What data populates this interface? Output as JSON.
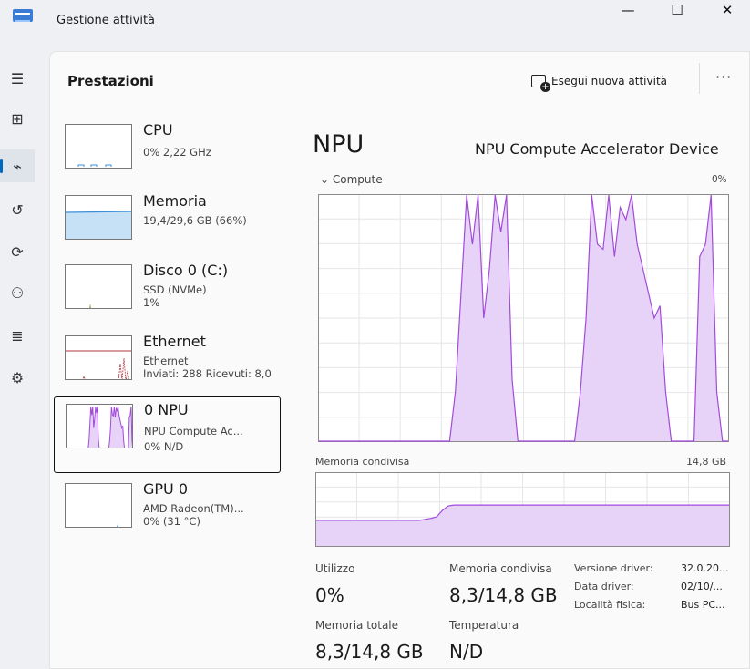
{
  "window": {
    "title": "Gestione attività",
    "minimize_glyph": "—",
    "maximize_glyph": "☐",
    "close_glyph": "✕"
  },
  "rail": {
    "items": [
      {
        "icon": "hamburger-icon",
        "glyph": "☰"
      },
      {
        "icon": "processes-icon",
        "glyph": "⊞"
      },
      {
        "icon": "performance-icon",
        "glyph": "⌁",
        "active": true
      },
      {
        "icon": "app-history-icon",
        "glyph": "↺"
      },
      {
        "icon": "startup-apps-icon",
        "glyph": "⟳"
      },
      {
        "icon": "users-icon",
        "glyph": "⚇"
      },
      {
        "icon": "details-icon",
        "glyph": "≣"
      },
      {
        "icon": "services-icon",
        "glyph": "⚙"
      }
    ]
  },
  "header": {
    "title": "Prestazioni",
    "run_task_label": "Esegui nuova attività",
    "more_glyph": "···"
  },
  "sidebar": {
    "items": [
      {
        "name": "CPU",
        "line1": "0% 2,22 GHz",
        "line2": ""
      },
      {
        "name": "Memoria",
        "line1": "19,4/29,6 GB (66%)",
        "line2": ""
      },
      {
        "name": "Disco 0 (C:)",
        "line1": "SSD (NVMe)",
        "line2": "1%"
      },
      {
        "name": "Ethernet",
        "line1": "Ethernet",
        "line2": "Inviati: 288 Ricevuti: 8,0"
      },
      {
        "name": "0 NPU",
        "line1": "NPU Compute Ac...",
        "line2": "0% N/D",
        "selected": true
      },
      {
        "name": "GPU 0",
        "line1": "AMD Radeon(TM)...",
        "line2": "0% (31 °C)"
      }
    ]
  },
  "detail": {
    "title": "NPU",
    "device": "NPU Compute Accelerator Device",
    "compute_label": "Compute",
    "compute_max": "0%",
    "shared_label": "Memoria condivisa",
    "shared_max": "14,8 GB",
    "stats": {
      "utilization_label": "Utilizzo",
      "utilization_value": "0%",
      "shared_label": "Memoria condivisa",
      "shared_value": "8,3/14,8 GB",
      "total_label": "Memoria totale",
      "total_value": "8,3/14,8 GB",
      "temp_label": "Temperatura",
      "temp_value": "N/D"
    },
    "info": [
      {
        "key": "Versione driver:",
        "value": "32.0.20..."
      },
      {
        "key": "Data driver:",
        "value": "02/10/..."
      },
      {
        "key": "Località fisica:",
        "value": "Bus PC..."
      }
    ]
  },
  "colors": {
    "npu_line": "#a24bd9",
    "npu_fill": "#e7d3f7",
    "memory_line": "#3f8fd6",
    "memory_fill": "#c6e0f5",
    "disk_line": "#6a9a2a",
    "ethernet_line": "#b2363d",
    "accent": "#0067c0"
  },
  "chart_data": [
    {
      "type": "area",
      "title": "Compute",
      "y_max_label": "0%",
      "ylim": [
        0,
        100
      ],
      "grid": true,
      "values": [
        0,
        0,
        0,
        0,
        0,
        0,
        0,
        0,
        0,
        0,
        0,
        0,
        0,
        0,
        0,
        0,
        0,
        0,
        0,
        0,
        0,
        0,
        0,
        0,
        20,
        60,
        100,
        80,
        100,
        50,
        70,
        100,
        85,
        100,
        25,
        0,
        0,
        0,
        0,
        0,
        0,
        0,
        0,
        0,
        0,
        0,
        20,
        50,
        100,
        80,
        78,
        100,
        75,
        95,
        90,
        100,
        80,
        70,
        60,
        50,
        55,
        20,
        0,
        0,
        0,
        0,
        0,
        75,
        80,
        100,
        20,
        0,
        0
      ]
    },
    {
      "type": "area",
      "title": "Memoria condivisa",
      "y_max_label": "14,8 GB",
      "ylim": [
        0,
        14.8
      ],
      "grid": true,
      "values": [
        5.2,
        5.2,
        5.2,
        5.2,
        5.2,
        5.2,
        5.2,
        5.2,
        5.2,
        5.2,
        5.2,
        5.2,
        5.2,
        5.2,
        5.2,
        5.2,
        5.2,
        5.2,
        5.2,
        5.4,
        5.6,
        5.9,
        7.2,
        8.1,
        8.3,
        8.3,
        8.3,
        8.3,
        8.3,
        8.3,
        8.3,
        8.3,
        8.3,
        8.3,
        8.3,
        8.3,
        8.3,
        8.3,
        8.3,
        8.3,
        8.3,
        8.3,
        8.3,
        8.3,
        8.3,
        8.3,
        8.3,
        8.3,
        8.3,
        8.3,
        8.3,
        8.3,
        8.3,
        8.3,
        8.3,
        8.3,
        8.3,
        8.3,
        8.3,
        8.3,
        8.3,
        8.3,
        8.3,
        8.3,
        8.3,
        8.3,
        8.3,
        8.3,
        8.3,
        8.3,
        8.3,
        8.3,
        8.3
      ]
    }
  ]
}
